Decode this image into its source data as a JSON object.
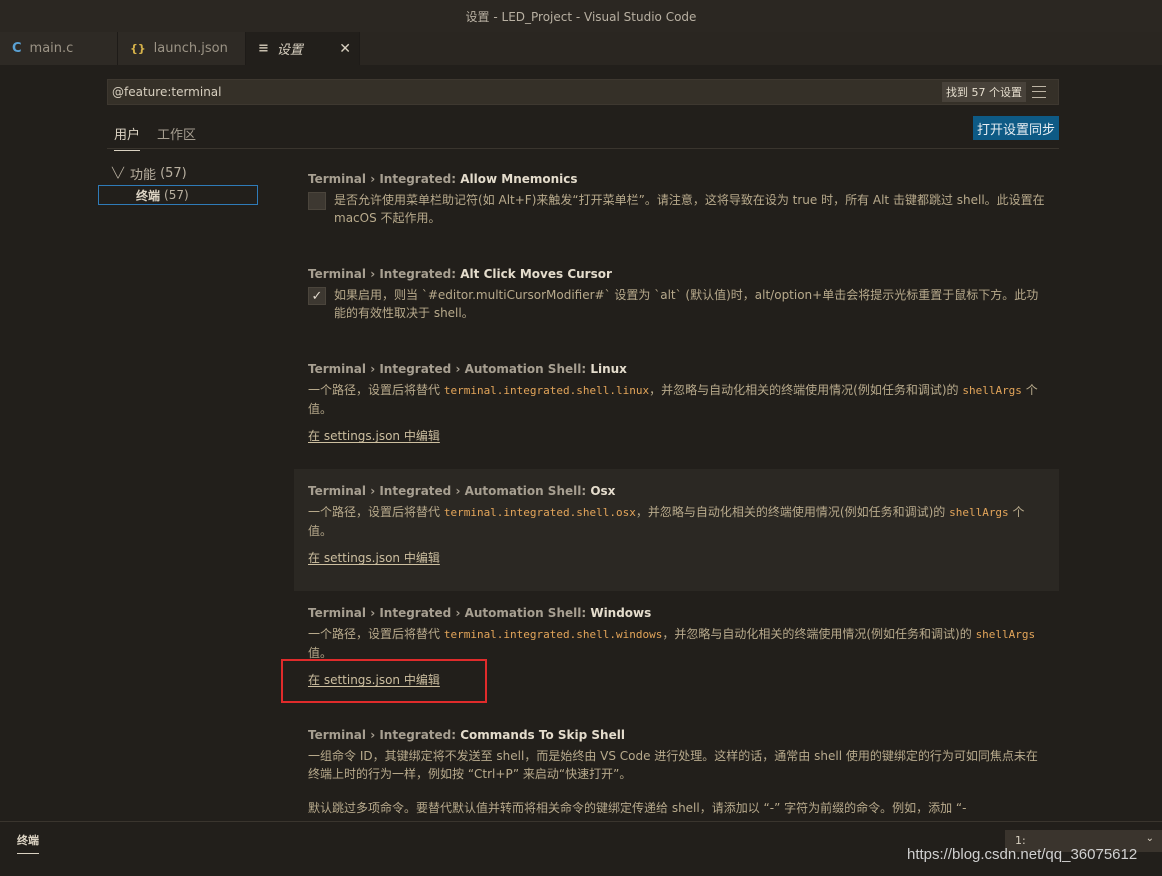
{
  "window": {
    "title": "设置 - LED_Project - Visual Studio Code"
  },
  "tabs": [
    {
      "icon": "C",
      "label": "main.c"
    },
    {
      "icon": "{}",
      "label": "launch.json"
    },
    {
      "icon": "≡",
      "label": "设置",
      "close": "✕"
    }
  ],
  "search": {
    "value": "@feature:terminal",
    "result_count": "找到 57 个设置"
  },
  "scope": {
    "user": "用户",
    "workspace": "工作区",
    "sync_button": "打开设置同步"
  },
  "toc": {
    "group_label": "功能",
    "group_count": "(57)",
    "item_label": "终端",
    "item_count": "(57)"
  },
  "settings": [
    {
      "category": "Terminal › Integrated: ",
      "key": "Allow Mnemonics",
      "checked": false,
      "description": "是否允许使用菜单栏助记符(如 Alt+F)来触发“打开菜单栏”。请注意，这将导致在设为 true 时，所有 Alt 击键都跳过 shell。此设置在 macOS 不起作用。"
    },
    {
      "category": "Terminal › Integrated: ",
      "key": "Alt Click Moves Cursor",
      "checked": true,
      "check_glyph": "✓",
      "description": "如果启用，则当 `#editor.multiCursorModifier#` 设置为 `alt` (默认值)时，alt/option+单击会将提示光标重置于鼠标下方。此功能的有效性取决于 shell。"
    },
    {
      "category": "Terminal › Integrated › Automation Shell: ",
      "key": "Linux",
      "desc_prefix": "一个路径，设置后将替代 ",
      "code1": "terminal.integrated.shell.linux",
      "desc_mid": "，并忽略与自动化相关的终端使用情况(例如任务和调试)的 ",
      "code2": "shellArgs",
      "desc_suffix": " 个值。",
      "link": "在 settings.json 中编辑"
    },
    {
      "category": "Terminal › Integrated › Automation Shell: ",
      "key": "Osx",
      "desc_prefix": "一个路径，设置后将替代 ",
      "code1": "terminal.integrated.shell.osx",
      "desc_mid": "，并忽略与自动化相关的终端使用情况(例如任务和调试)的 ",
      "code2": "shellArgs",
      "desc_suffix": " 个值。",
      "link": "在 settings.json 中编辑"
    },
    {
      "category": "Terminal › Integrated › Automation Shell: ",
      "key": "Windows",
      "desc_prefix": "一个路径，设置后将替代 ",
      "code1": "terminal.integrated.shell.windows",
      "desc_mid": "，并忽略与自动化相关的终端使用情况(例如任务和调试)的 ",
      "code2": "shellArgs",
      "desc_suffix": " 值。",
      "link": "在 settings.json 中编辑"
    },
    {
      "category": "Terminal › Integrated: ",
      "key": "Commands To Skip Shell",
      "description": "一组命令 ID，其键绑定将不发送至 shell，而是始终由 VS Code 进行处理。这样的话，通常由 shell 使用的键绑定的行为可如同焦点未在终端上时的行为一样，例如按 “Ctrl+P” 来启动“快速打开”。",
      "description2": "默认跳过多项命令。要替代默认值并转而将相关命令的键绑定传递给 shell，请添加以 “-” 字符为前缀的命令。例如，添加 “-"
    }
  ],
  "panel": {
    "tab": "终端",
    "terminal_select": "1:",
    "watermark": "https://blog.csdn.net/qq_36075612"
  },
  "colors": {
    "accent_button": "#0e5a85",
    "focus_border": "#2f7bb8",
    "highlight_box": "#e02b2b"
  }
}
